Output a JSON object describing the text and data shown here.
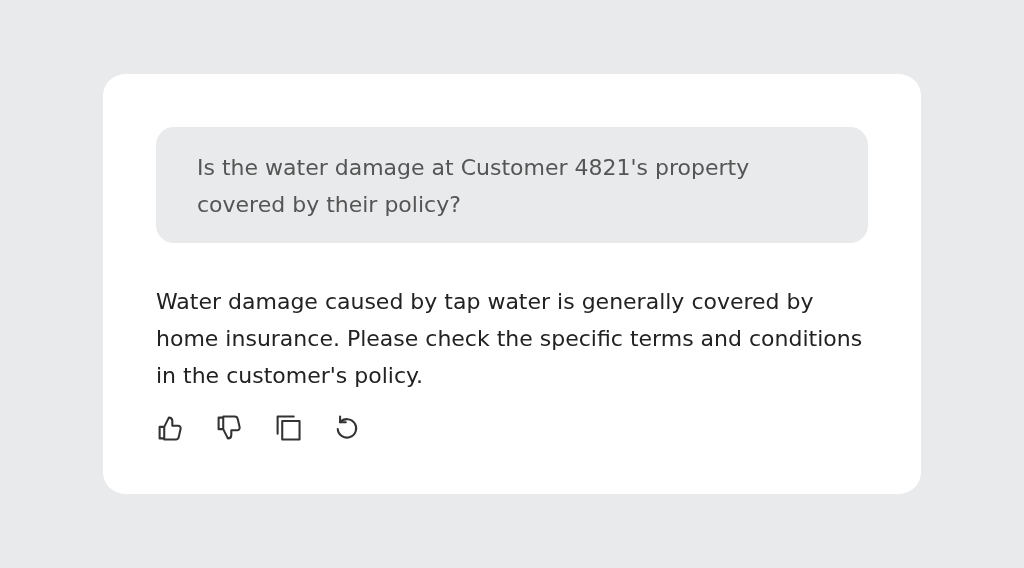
{
  "question": "Is the water damage at Customer 4821's property covered by their policy?",
  "answer": "Water damage caused by tap water is generally covered by home insurance. Please check the specific terms and conditions in the customer's policy.",
  "actions": [
    {
      "kind": "like"
    },
    {
      "kind": "dislike"
    },
    {
      "kind": "copy"
    },
    {
      "kind": "retry"
    }
  ]
}
